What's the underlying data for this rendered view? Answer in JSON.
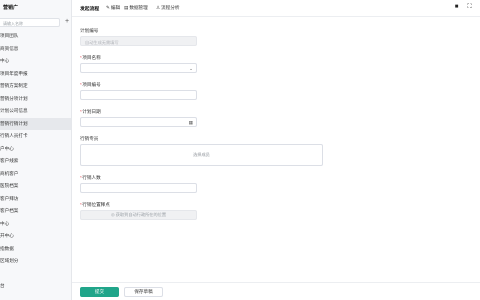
{
  "sidebar": {
    "brand": "营销广",
    "search_placeholder": "请输入名称",
    "add_icon": "plus-icon",
    "items": [
      "项目团队",
      "商资信息",
      "中心",
      "项目年度申报",
      "营销方案制定",
      "营销分项计划",
      "计划公司信息",
      "营销行销计划",
      "行销人员打卡",
      "户中心",
      "客户线索",
      "商机客户",
      "医院档案",
      "客户拜访",
      "客户档案",
      "中心",
      "开中心",
      "指数据",
      "区域划分"
    ],
    "active_index": 7,
    "last_item": "台"
  },
  "topbar": {
    "title": "发起流程",
    "actions": [
      {
        "icon": "edit-icon",
        "glyph": "✎",
        "label": "编辑"
      },
      {
        "icon": "data-manage-icon",
        "glyph": "▤",
        "label": "数据管理"
      },
      {
        "icon": "flow-analysis-icon",
        "glyph": "♙",
        "label": "流程分析"
      }
    ],
    "right_icons": [
      "dark-square-icon",
      "fullscreen-icon"
    ]
  },
  "form": {
    "plan_no": {
      "label": "计划编号",
      "placeholder": "自动生成无需填写"
    },
    "project_name": {
      "label": "项目名称",
      "required": "*",
      "chevron": "⌄"
    },
    "project_no": {
      "label": "项目编号",
      "required": "*"
    },
    "plan_date": {
      "label": "计划日期",
      "required": "*",
      "calendar": "▦"
    },
    "plan_attachment": {
      "label": "行销专员",
      "button": "选择成员"
    },
    "marketer": {
      "label": "行销人数",
      "required": "*"
    },
    "location": {
      "label": "行销位置释点",
      "required": "*",
      "placeholder": "◎ 获取到自动行政所在的位置"
    }
  },
  "footer": {
    "submit_label": "提交",
    "save_draft_label": "保存草稿"
  }
}
